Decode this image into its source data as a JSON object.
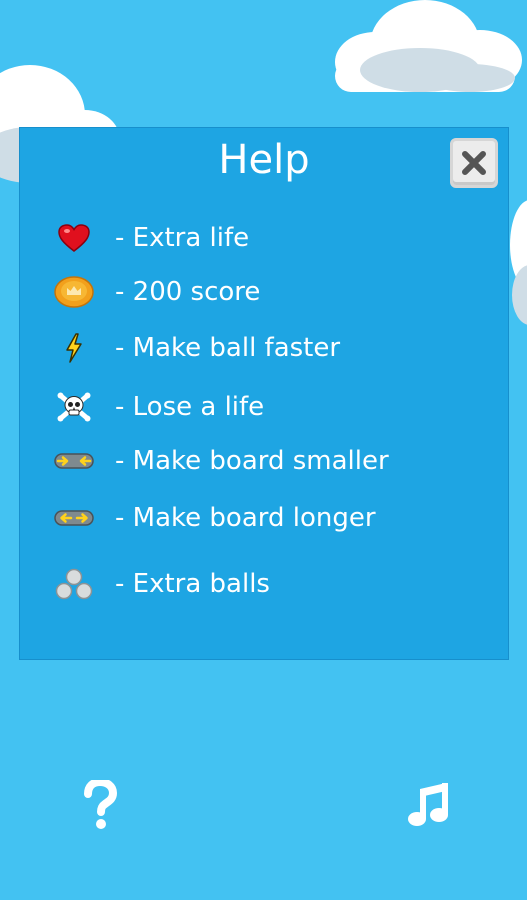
{
  "dialog": {
    "title": "Help",
    "close_icon": "close-x-icon",
    "items": [
      {
        "icon": "heart-icon",
        "label": "- Extra life"
      },
      {
        "icon": "coin-icon",
        "label": "- 200 score"
      },
      {
        "icon": "lightning-icon",
        "label": "- Make ball faster"
      },
      {
        "icon": "skull-crossbones-icon",
        "label": "- Lose a life"
      },
      {
        "icon": "shrink-board-icon",
        "label": "- Make board smaller"
      },
      {
        "icon": "extend-board-icon",
        "label": "- Make board longer"
      },
      {
        "icon": "three-balls-icon",
        "label": "- Extra balls"
      }
    ]
  },
  "bottom_bar": {
    "help_icon": "question-mark-icon",
    "music_icon": "music-note-icon"
  },
  "colors": {
    "sky": "#43c2f2",
    "panel": "#1ea5e3",
    "text": "#ffffff",
    "cloud": "#ffffff",
    "cloud_shadow": "#cfdde6"
  }
}
